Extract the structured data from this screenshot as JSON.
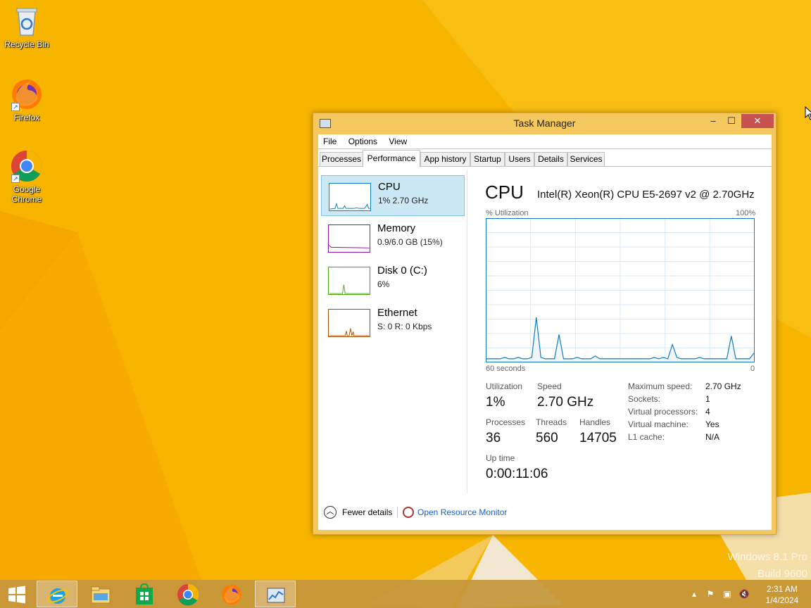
{
  "desktop": {
    "icons": [
      {
        "label": "Recycle Bin",
        "icon": "recycle-bin-icon"
      },
      {
        "label": "Firefox",
        "icon": "firefox-icon"
      },
      {
        "label": "Google Chrome",
        "icon": "chrome-icon"
      }
    ],
    "watermark_line1": "Windows 8.1 Pro",
    "watermark_line2": "Build 9600"
  },
  "window": {
    "title": "Task Manager",
    "minimize_glyph": "–",
    "maximize_glyph": "☐",
    "close_glyph": "✕"
  },
  "menu": [
    "File",
    "Options",
    "View"
  ],
  "tabs": [
    "Processes",
    "Performance",
    "App history",
    "Startup",
    "Users",
    "Details",
    "Services"
  ],
  "active_tab": "Performance",
  "resources": [
    {
      "name": "CPU",
      "detail": "1%  2.70 GHz",
      "color": "#117dbb"
    },
    {
      "name": "Memory",
      "detail": "0.9/6.0 GB (15%)",
      "color": "#8b12ae"
    },
    {
      "name": "Disk 0 (C:)",
      "detail": "6%",
      "color": "#4da60c"
    },
    {
      "name": "Ethernet",
      "detail": "S: 0  R: 0 Kbps",
      "color": "#a74f01"
    }
  ],
  "cpu": {
    "title": "CPU",
    "model": "Intel(R) Xeon(R) CPU E5-2697 v2 @ 2.70GHz",
    "graph_label_left": "% Utilization",
    "graph_label_right": "100%",
    "graph_bottom_left": "60 seconds",
    "graph_bottom_right": "0",
    "utilization_pct_series": [
      2,
      2,
      2,
      2,
      3,
      2,
      2,
      3,
      2,
      2,
      3,
      31,
      3,
      2,
      2,
      2,
      19,
      2,
      2,
      2,
      3,
      2,
      2,
      2,
      4,
      2,
      2,
      2,
      2,
      2,
      2,
      2,
      2,
      2,
      2,
      2,
      2,
      3,
      2,
      3,
      2,
      12,
      3,
      2,
      2,
      2,
      2,
      3,
      2,
      2,
      2,
      2,
      2,
      2,
      18,
      2,
      2,
      2,
      2,
      6
    ],
    "stats": {
      "utilization_label": "Utilization",
      "utilization_value": "1%",
      "speed_label": "Speed",
      "speed_value": "2.70 GHz",
      "processes_label": "Processes",
      "processes_value": "36",
      "threads_label": "Threads",
      "threads_value": "560",
      "handles_label": "Handles",
      "handles_value": "14705",
      "uptime_label": "Up time",
      "uptime_value": "0:00:11:06"
    },
    "details": [
      {
        "key": "Maximum speed:",
        "value": "2.70 GHz"
      },
      {
        "key": "Sockets:",
        "value": "1"
      },
      {
        "key": "Virtual processors:",
        "value": "4"
      },
      {
        "key": "Virtual machine:",
        "value": "Yes"
      },
      {
        "key": "L1 cache:",
        "value": "N/A"
      }
    ]
  },
  "footer": {
    "fewer_details": "Fewer details",
    "open_resource_monitor": "Open Resource Monitor"
  },
  "taskbar": {
    "apps": [
      {
        "name": "start-button"
      },
      {
        "name": "internet-explorer-icon"
      },
      {
        "name": "file-explorer-icon"
      },
      {
        "name": "store-icon"
      },
      {
        "name": "chrome-icon"
      },
      {
        "name": "firefox-icon"
      },
      {
        "name": "task-manager-icon"
      }
    ],
    "time": "2:31 AM",
    "date": "1/4/2024"
  },
  "colors": {
    "desktop_accent": "#f6b400",
    "cpu_graph_line": "#117dbb",
    "cpu_graph_fill": "#f1f6fa",
    "selected_bg": "#cce8f4",
    "link_blue": "#1a5ec5"
  }
}
